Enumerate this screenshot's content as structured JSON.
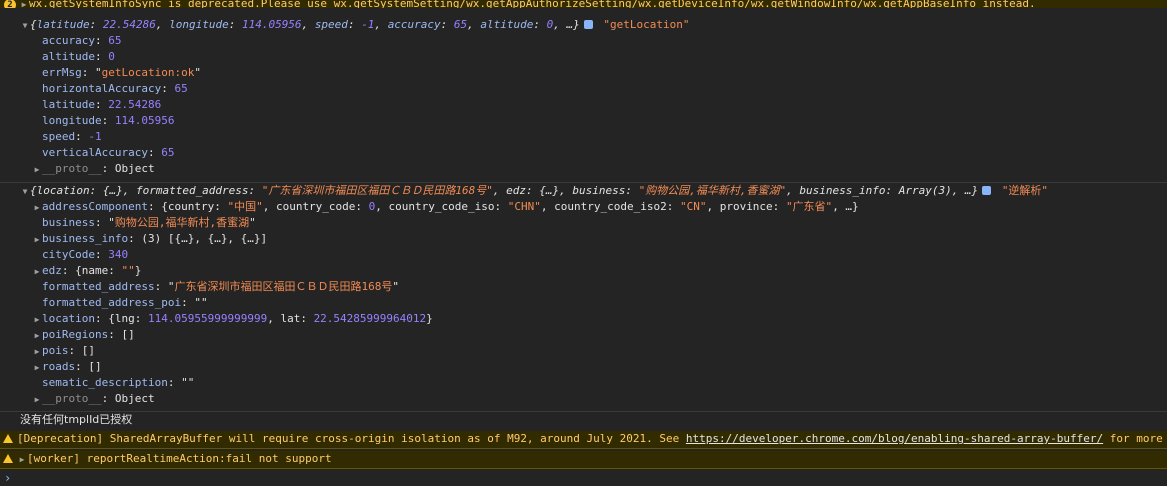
{
  "top_warning": {
    "badge": "2",
    "text": "wx.getSystemInfoSync is deprecated.Please use wx.getSystemSetting/wx.getAppAuthorizeSetting/wx.getDeviceInfo/wx.getWindowInfo/wx.getAppBaseInfo instead."
  },
  "location_log": {
    "summary": {
      "open": "{",
      "k1": "latitude",
      "v1": "22.54286",
      "k2": "longitude",
      "v2": "114.05956",
      "k3": "speed",
      "v3": "-1",
      "k4": "accuracy",
      "v4": "65",
      "k5": "altitude",
      "v5": "0",
      "tail": ", …}",
      "tag": "\"getLocation\""
    },
    "props": [
      {
        "key": "accuracy",
        "value": "65",
        "kind": "num"
      },
      {
        "key": "altitude",
        "value": "0",
        "kind": "num"
      },
      {
        "key": "errMsg",
        "value": "getLocation:ok",
        "kind": "str"
      },
      {
        "key": "horizontalAccuracy",
        "value": "65",
        "kind": "num"
      },
      {
        "key": "latitude",
        "value": "22.54286",
        "kind": "num"
      },
      {
        "key": "longitude",
        "value": "114.05956",
        "kind": "num"
      },
      {
        "key": "speed",
        "value": "-1",
        "kind": "num"
      },
      {
        "key": "verticalAccuracy",
        "value": "65",
        "kind": "num"
      }
    ],
    "proto_key": "__proto__",
    "proto_value": "Object"
  },
  "geo_log": {
    "summary": {
      "p1": "{location: {…}, formatted_address: ",
      "s1": "\"广东省深圳市福田区福田ＣＢＤ民田路168号\"",
      "p2": ", edz: {…}, business: ",
      "s2": "\"购物公园,福华新村,香蜜湖\"",
      "p3": ", business_info: Array(3), …}",
      "tag": "\"逆解析\""
    },
    "addressComponent": {
      "key": "addressComponent",
      "a": "{country: ",
      "b": "\"中国\"",
      "c": ", country_code: ",
      "d": "0",
      "e": ", country_code_iso: ",
      "f": "\"CHN\"",
      "g": ", country_code_iso2: ",
      "h": "\"CN\"",
      "i": ", province: ",
      "j": "\"广东省\"",
      "k": ", …}"
    },
    "business": {
      "key": "business",
      "value": "购物公园,福华新村,香蜜湖"
    },
    "business_info": {
      "key": "business_info",
      "value": "(3) [{…}, {…}, {…}]"
    },
    "cityCode": {
      "key": "cityCode",
      "value": "340"
    },
    "edz": {
      "key": "edz",
      "a": "{name: ",
      "b": "\"\"",
      "c": "}"
    },
    "formatted_address": {
      "key": "formatted_address",
      "value": "广东省深圳市福田区福田ＣＢＤ民田路168号"
    },
    "formatted_address_poi": {
      "key": "formatted_address_poi",
      "value": "\"\""
    },
    "location": {
      "key": "location",
      "a": "{lng: ",
      "lng": "114.05955999999999",
      "b": ", lat: ",
      "lat": "22.54285999964012",
      "c": "}"
    },
    "poiRegions": {
      "key": "poiRegions",
      "value": "[]"
    },
    "pois": {
      "key": "pois",
      "value": "[]"
    },
    "roads": {
      "key": "roads",
      "value": "[]"
    },
    "sematic_description": {
      "key": "sematic_description",
      "value": "\"\""
    },
    "proto_key": "__proto__",
    "proto_value": "Object"
  },
  "plain_log": "没有任何tmplId已授权",
  "deprecation_warning": {
    "prefix": "[Deprecation] SharedArrayBuffer will require cross-origin isolation as of M92, around July 2021. See ",
    "link": "https://developer.chrome.com/blog/enabling-shared-array-buffer/",
    "suffix": " for more"
  },
  "worker_warning": "[worker] reportRealtimeAction:fail not support",
  "prompt": "›",
  "colors": {
    "warning_bg": "#332b00",
    "string": "#f28b54",
    "number": "#9980ff",
    "key": "#9fbaf0"
  }
}
